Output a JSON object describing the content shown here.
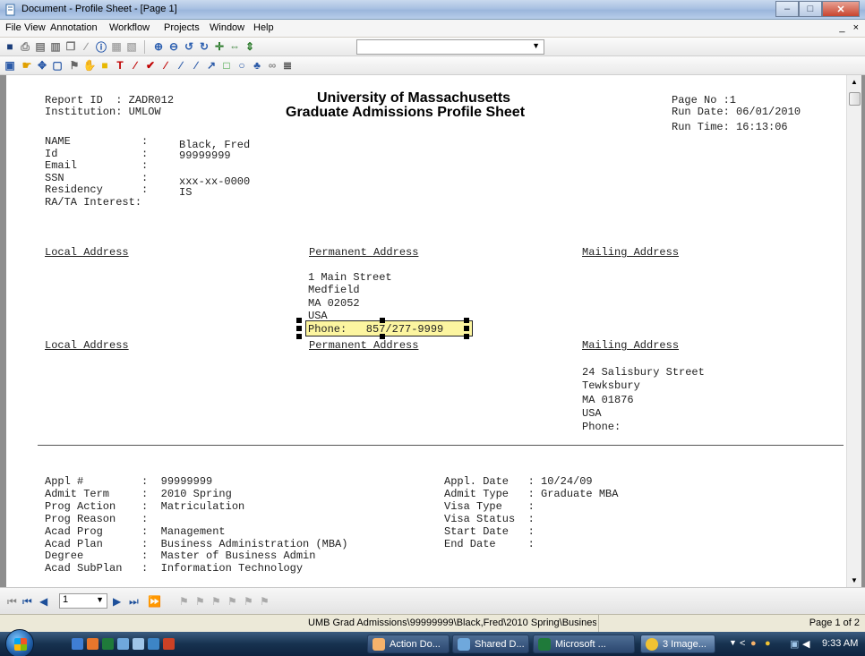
{
  "window": {
    "title": "Document - Profile Sheet - [Page 1]"
  },
  "menu": {
    "items": [
      "File",
      "View",
      "Annotation",
      "Workflow",
      "Projects",
      "Window",
      "Help"
    ],
    "mdi_controls": "_ ×"
  },
  "colors": {
    "annotation_fill": "#fcf5a0",
    "taskbar": "#17324f",
    "page_background": "#ffffff"
  },
  "report": {
    "left_header": {
      "line1": "Report ID  : ZADR012",
      "line2": "Institution: UMLOW"
    },
    "title1": "University of Massachusetts",
    "title2": "Graduate Admissions Profile Sheet",
    "right_header": {
      "line1": "Page No :1",
      "line2": "Run Date: 06/01/2010",
      "line3": "Run Time: 16:13:06"
    },
    "person": {
      "labels": "NAME           :\nId             :\nEmail          :\nSSN            :\nResidency      :\nRA/TA Interest:",
      "name": "Black, Fred",
      "id": "99999999",
      "ssn": "xxx-xx-0000",
      "residency": "IS"
    },
    "section1": {
      "local": "Local Address",
      "permanent": "Permanent Address",
      "mailing": "Mailing Address"
    },
    "permanent_address": {
      "line1": "1 Main Street",
      "line2": "Medfield",
      "line3": "MA 02052",
      "line4": "USA",
      "phone": "Phone:   857/277-9999"
    },
    "section2": {
      "local": "Local Address",
      "permanent": "Permanent Address",
      "mailing": "Mailing Address"
    },
    "mailing_address": {
      "line1": "24 Salisbury Street",
      "line2": "Tewksbury",
      "line3": "MA 01876",
      "line4": "USA",
      "phone": "Phone:"
    },
    "application_left": "Appl #         :  99999999\nAdmit Term     :  2010 Spring\nProg Action    :  Matriculation\nProg Reason    :\nAcad Prog      :  Management\nAcad Plan      :  Business Administration (MBA)\nDegree         :  Master of Business Admin\nAcad SubPlan   :  Information Technology",
    "application_right": "Appl. Date   : 10/24/09\nAdmit Type   : Graduate MBA\nVisa Type    :\nVisa Status  :\nStart Date   :\nEnd Date     :"
  },
  "nav": {
    "current_page": "1"
  },
  "status": {
    "path": "UMB Grad Admissions\\99999999\\Black,Fred\\2010 Spring\\Busines",
    "page": "Page 1 of 2"
  },
  "taskbar": {
    "tasks": [
      "Action Do...",
      "Shared D...",
      "Microsoft ...",
      "3 Image..."
    ],
    "time": "9:33 AM"
  }
}
